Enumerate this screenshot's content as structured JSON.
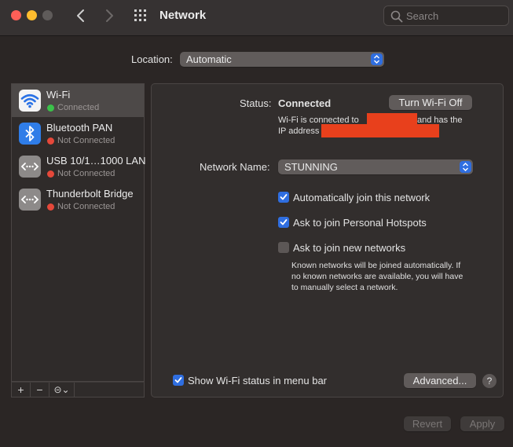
{
  "window": {
    "title": "Network"
  },
  "search": {
    "placeholder": "Search"
  },
  "location": {
    "label": "Location:",
    "value": "Automatic"
  },
  "services": [
    {
      "name": "Wi-Fi",
      "status": "Connected",
      "status_color": "#3bc14a",
      "icon": "wifi-icon",
      "selected": true
    },
    {
      "name": "Bluetooth PAN",
      "status": "Not Connected",
      "status_color": "#e5483a",
      "icon": "bluetooth-icon",
      "selected": false
    },
    {
      "name": "USB 10/1…1000 LAN",
      "status": "Not Connected",
      "status_color": "#e5483a",
      "icon": "ethernet-icon",
      "selected": false
    },
    {
      "name": "Thunderbolt Bridge",
      "status": "Not Connected",
      "status_color": "#e5483a",
      "icon": "ethernet-icon",
      "selected": false
    }
  ],
  "sidebar_bar": {
    "add": "+",
    "remove": "−",
    "action": "⊝⌄"
  },
  "detail": {
    "status_label": "Status:",
    "status_value": "Connected",
    "turn_off_button": "Turn Wi-Fi Off",
    "info_line1_a": "Wi-Fi is connected to",
    "info_line1_b": "and has the",
    "info_line2": "IP address",
    "network_name_label": "Network Name:",
    "network_name_value": "STUNNING",
    "options": [
      {
        "label": "Automatically join this network",
        "checked": true
      },
      {
        "label": "Ask to join Personal Hotspots",
        "checked": true
      },
      {
        "label": "Ask to join new networks",
        "checked": false
      }
    ],
    "hint": [
      "Known networks will be joined automatically. If",
      "no known networks are available, you will have",
      "to manually select a network."
    ],
    "show_status_label": "Show Wi-Fi status in menu bar",
    "show_status_checked": true,
    "advanced_button": "Advanced...",
    "help_button": "?"
  },
  "footer": {
    "revert": "Revert",
    "apply": "Apply"
  },
  "colors": {
    "accent": "#2f6ee0",
    "redaction": "#e8401c"
  }
}
